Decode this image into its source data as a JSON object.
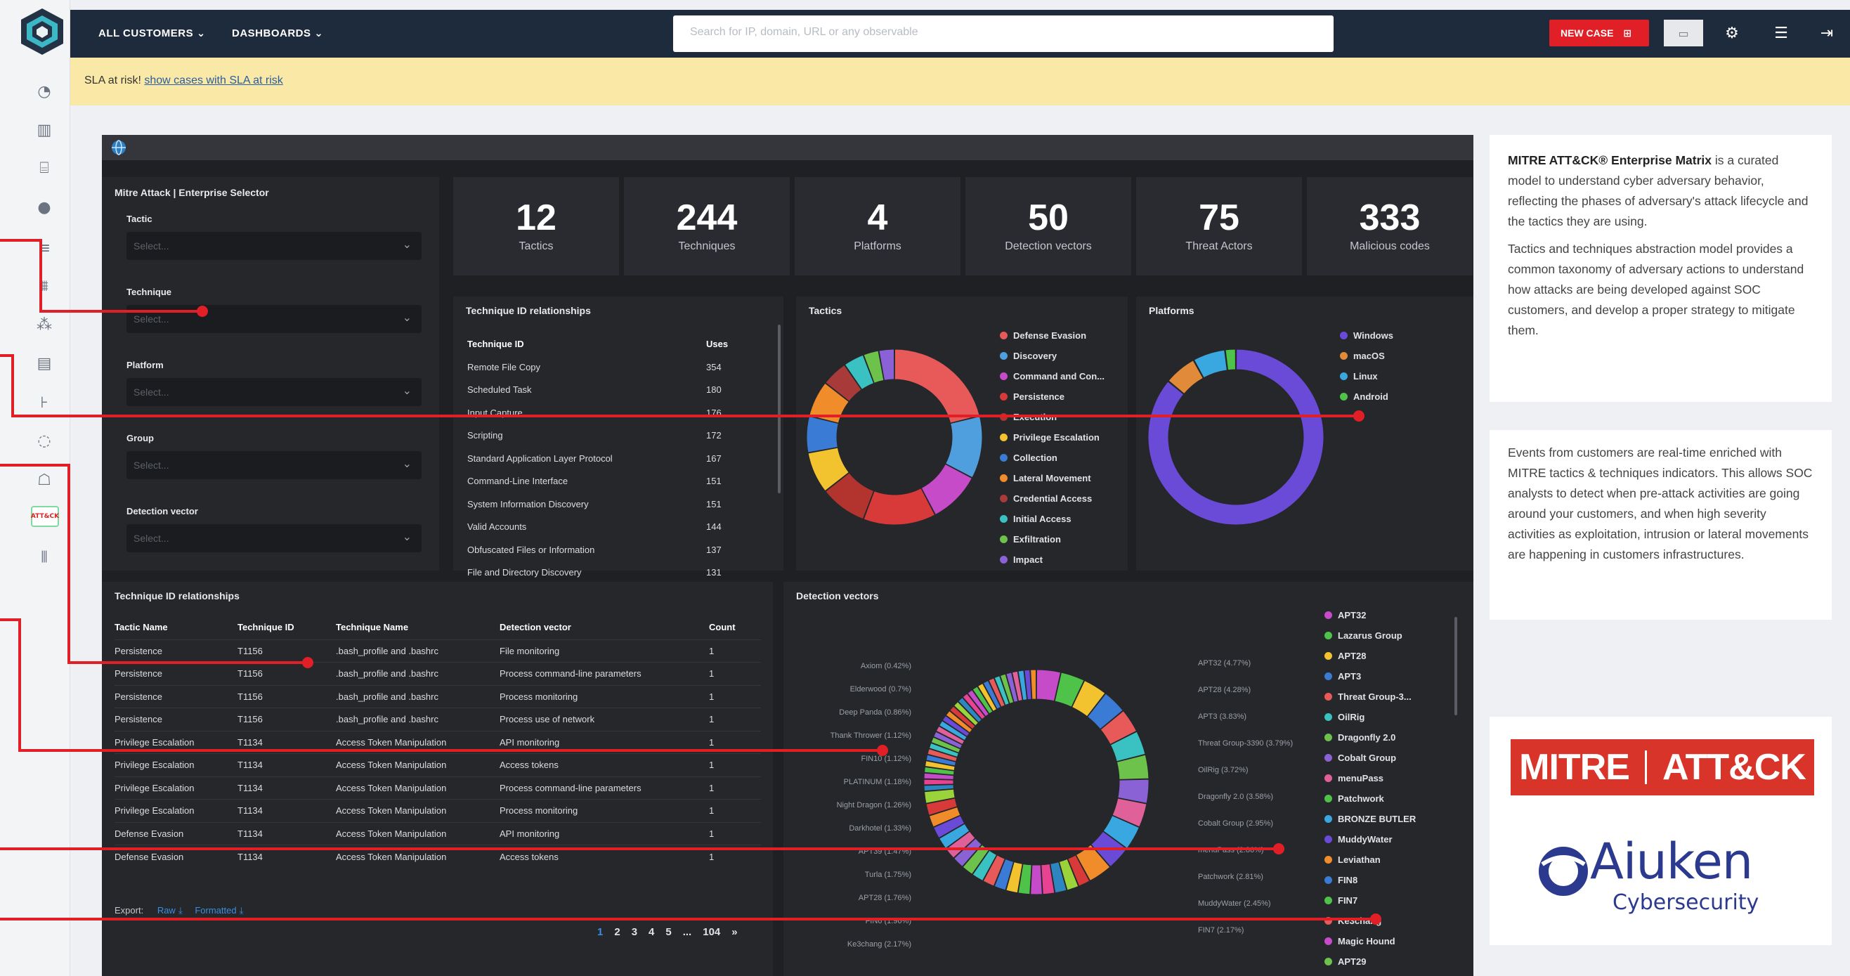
{
  "topbar": {
    "menu_customers": "ALL CUSTOMERS",
    "menu_dashboards": "DASHBOARDS",
    "search_placeholder": "Search for IP, domain, URL or any observable",
    "new_case": "NEW CASE"
  },
  "sla": {
    "text": "SLA at risk!",
    "link": "show cases with SLA at risk"
  },
  "selector": {
    "title": "Mitre Attack | Enterprise Selector",
    "fields": [
      {
        "label": "Tactic",
        "placeholder": "Select..."
      },
      {
        "label": "Technique",
        "placeholder": "Select..."
      },
      {
        "label": "Platform",
        "placeholder": "Select..."
      },
      {
        "label": "Group",
        "placeholder": "Select..."
      },
      {
        "label": "Detection vector",
        "placeholder": "Select..."
      }
    ]
  },
  "stats": [
    {
      "value": "12",
      "label": "Tactics"
    },
    {
      "value": "244",
      "label": "Techniques"
    },
    {
      "value": "4",
      "label": "Platforms"
    },
    {
      "value": "50",
      "label": "Detection vectors"
    },
    {
      "value": "75",
      "label": "Threat Actors"
    },
    {
      "value": "333",
      "label": "Malicious codes"
    }
  ],
  "uses_table": {
    "title": "Technique ID relationships",
    "headers": [
      "Technique ID",
      "Uses"
    ],
    "rows": [
      [
        "Remote File Copy",
        "354"
      ],
      [
        "Scheduled Task",
        "180"
      ],
      [
        "Input Capture",
        "176"
      ],
      [
        "Scripting",
        "172"
      ],
      [
        "Standard Application Layer Protocol",
        "167"
      ],
      [
        "Command-Line Interface",
        "151"
      ],
      [
        "System Information Discovery",
        "151"
      ],
      [
        "Valid Accounts",
        "144"
      ],
      [
        "Obfuscated Files or Information",
        "137"
      ],
      [
        "File and Directory Discovery",
        "131"
      ]
    ]
  },
  "tactics_chart": {
    "title": "Tactics",
    "legend": [
      {
        "name": "Defense Evasion",
        "color": "#e8595a"
      },
      {
        "name": "Discovery",
        "color": "#4f9fdf"
      },
      {
        "name": "Command and Con...",
        "color": "#c54bc9"
      },
      {
        "name": "Persistence",
        "color": "#d83939"
      },
      {
        "name": "Execution",
        "color": "#b3332e"
      },
      {
        "name": "Privilege Escalation",
        "color": "#f2c32e"
      },
      {
        "name": "Collection",
        "color": "#3a7bd5"
      },
      {
        "name": "Lateral Movement",
        "color": "#f08c2a"
      },
      {
        "name": "Credential Access",
        "color": "#a83a3a"
      },
      {
        "name": "Initial Access",
        "color": "#3ac1c1"
      },
      {
        "name": "Exfiltration",
        "color": "#6cc24a"
      },
      {
        "name": "Impact",
        "color": "#8a62d6"
      }
    ]
  },
  "platforms_chart": {
    "title": "Platforms",
    "legend": [
      {
        "name": "Windows",
        "color": "#6a4bd8"
      },
      {
        "name": "macOS",
        "color": "#e08a3a"
      },
      {
        "name": "Linux",
        "color": "#3aa8e0"
      },
      {
        "name": "Android",
        "color": "#4fc24a"
      }
    ]
  },
  "relations_table": {
    "title": "Technique ID relationships",
    "headers": [
      "Tactic Name",
      "Technique ID",
      "Technique Name",
      "Detection vector",
      "Count"
    ],
    "rows": [
      [
        "Persistence",
        "T1156",
        ".bash_profile and .bashrc",
        "File monitoring",
        "1"
      ],
      [
        "Persistence",
        "T1156",
        ".bash_profile and .bashrc",
        "Process command-line parameters",
        "1"
      ],
      [
        "Persistence",
        "T1156",
        ".bash_profile and .bashrc",
        "Process monitoring",
        "1"
      ],
      [
        "Persistence",
        "T1156",
        ".bash_profile and .bashrc",
        "Process use of network",
        "1"
      ],
      [
        "Privilege Escalation",
        "T1134",
        "Access Token Manipulation",
        "API monitoring",
        "1"
      ],
      [
        "Privilege Escalation",
        "T1134",
        "Access Token Manipulation",
        "Access tokens",
        "1"
      ],
      [
        "Privilege Escalation",
        "T1134",
        "Access Token Manipulation",
        "Process command-line parameters",
        "1"
      ],
      [
        "Privilege Escalation",
        "T1134",
        "Access Token Manipulation",
        "Process monitoring",
        "1"
      ],
      [
        "Defense Evasion",
        "T1134",
        "Access Token Manipulation",
        "API monitoring",
        "1"
      ],
      [
        "Defense Evasion",
        "T1134",
        "Access Token Manipulation",
        "Access tokens",
        "1"
      ]
    ],
    "export_label": "Export:",
    "export_raw": "Raw",
    "export_formatted": "Formatted",
    "pages": [
      "1",
      "2",
      "3",
      "4",
      "5",
      "...",
      "104",
      "»"
    ]
  },
  "detection_chart": {
    "title": "Detection vectors",
    "left_labels": [
      "Axiom (0.42%)",
      "Elderwood (0.7%)",
      "Deep Panda (0.86%)",
      "Thank Thrower (1.12%)",
      "FIN10 (1.12%)",
      "PLATINUM (1.18%)",
      "Night Dragon (1.26%)",
      "Darkhotel (1.33%)",
      "APT39 (1.47%)",
      "Turla (1.75%)",
      "APT28 (1.76%)",
      "FIN6 (1.96%)",
      "Ke3chang (2.17%)"
    ],
    "right_labels": [
      "APT32 (4.77%)",
      "APT28 (4.28%)",
      "APT3 (3.83%)",
      "Threat Group-3390 (3.79%)",
      "OilRig (3.72%)",
      "Dragonfly 2.0 (3.58%)",
      "Cobalt Group (2.95%)",
      "menuPass (2.86%)",
      "Patchwork (2.81%)",
      "MuddyWater (2.45%)",
      "FIN7 (2.17%)"
    ],
    "legend": [
      {
        "name": "APT32",
        "color": "#c54bc9"
      },
      {
        "name": "Lazarus Group",
        "color": "#4fc24a"
      },
      {
        "name": "APT28",
        "color": "#f2c32e"
      },
      {
        "name": "APT3",
        "color": "#3a7bd5"
      },
      {
        "name": "Threat Group-3...",
        "color": "#e8595a"
      },
      {
        "name": "OilRig",
        "color": "#3ac1c1"
      },
      {
        "name": "Dragonfly 2.0",
        "color": "#6cc24a"
      },
      {
        "name": "Cobalt Group",
        "color": "#8a62d6"
      },
      {
        "name": "menuPass",
        "color": "#e0609a"
      },
      {
        "name": "Patchwork",
        "color": "#4fc24a"
      },
      {
        "name": "BRONZE BUTLER",
        "color": "#3aa8e0"
      },
      {
        "name": "MuddyWater",
        "color": "#6a4bd8"
      },
      {
        "name": "Leviathan",
        "color": "#f08c2a"
      },
      {
        "name": "FIN8",
        "color": "#3a7bd5"
      },
      {
        "name": "FIN7",
        "color": "#4fc24a"
      },
      {
        "name": "Ke3chang",
        "color": "#e8595a"
      },
      {
        "name": "Magic Hound",
        "color": "#c54bc9"
      },
      {
        "name": "APT29",
        "color": "#6cc24a"
      }
    ]
  },
  "info": {
    "p1_bold": "MITRE ATT&CK® Enterprise Matrix",
    "p1_rest": " is a curated model to understand cyber adversary behavior, reflecting the phases of adversary's attack lifecycle and the tactics they are using.",
    "p2": "Tactics and techniques abstraction model provides a common taxonomy of adversary actions to understand how attacks are being developed against SOC customers, and develop a proper strategy to mitigate them.",
    "p3": "Events from customers are real-time enriched with MITRE tactics & techniques indicators. This allows SOC analysts to detect when pre-attack activities are going around your customers, and when high severity activities as exploitation, intrusion or lateral movements are happening in customers infrastructures.",
    "mitre_logo_left": "MITRE",
    "mitre_logo_right": "ATT&CK",
    "aiuken_name": "Aiuken",
    "aiuken_sub": "Cybersecurity"
  },
  "sidebar_active_label": "ATT&CK"
}
